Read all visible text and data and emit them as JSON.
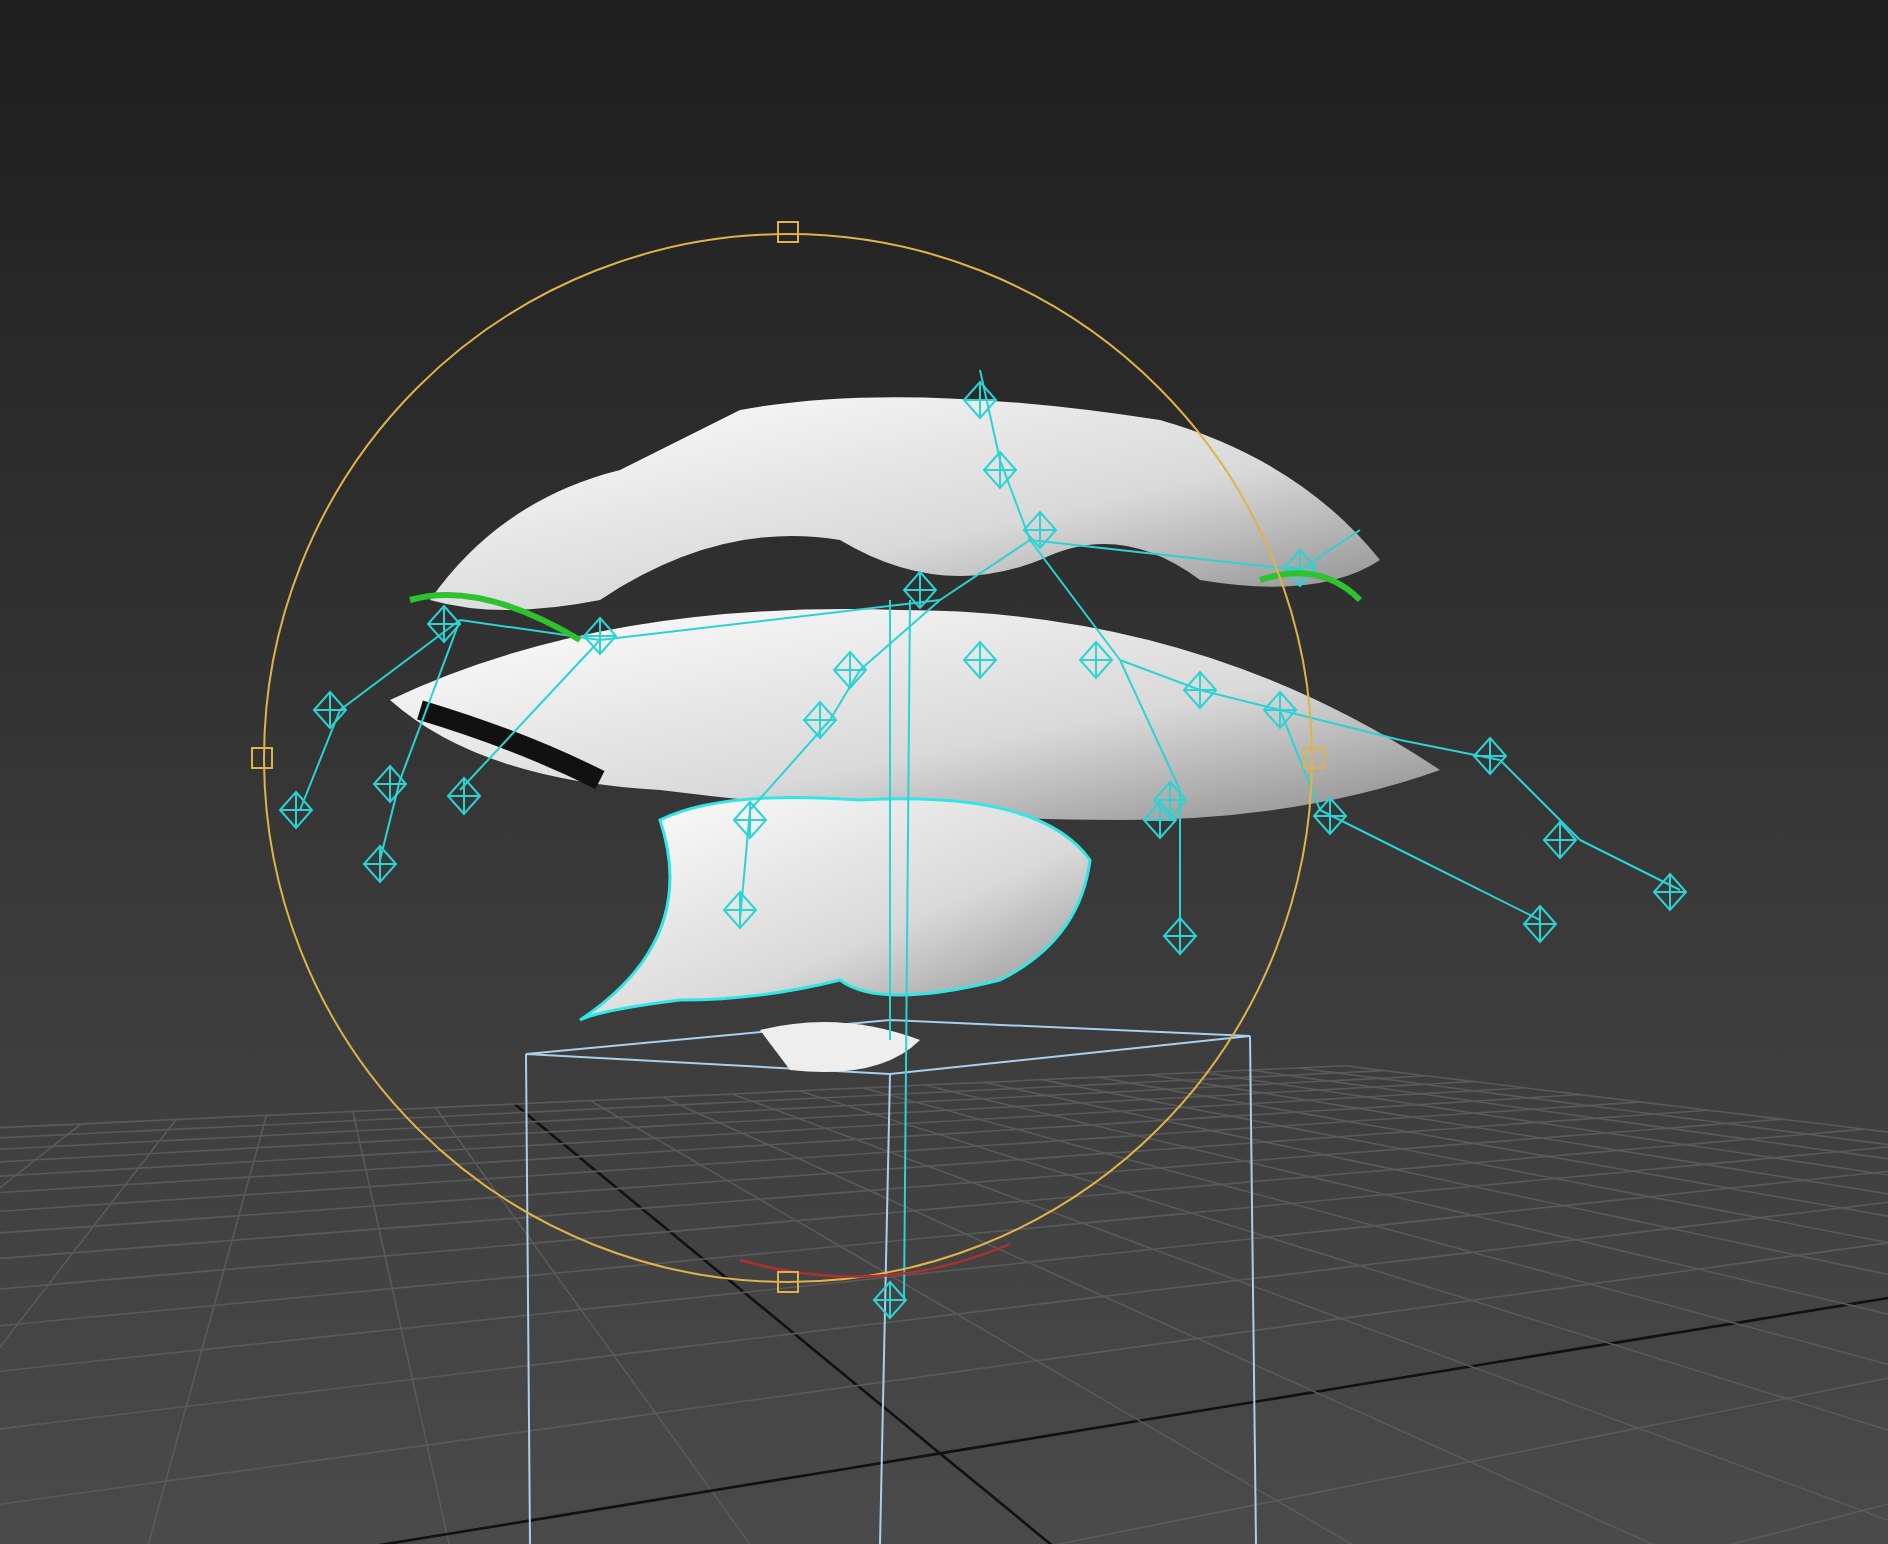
{
  "viewport": {
    "grid_visible": true,
    "gizmo_visible": true
  }
}
